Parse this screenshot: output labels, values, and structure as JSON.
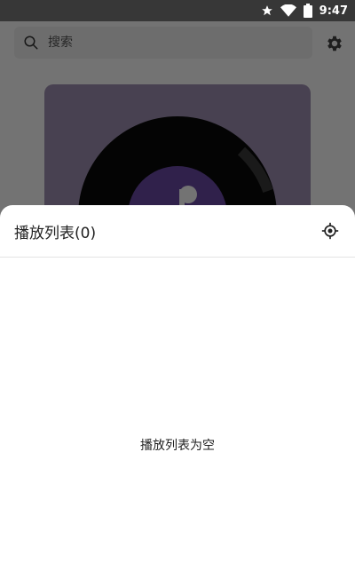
{
  "status_bar": {
    "time": "9:47",
    "icons": [
      "star-icon",
      "wifi-icon",
      "battery-icon"
    ]
  },
  "search": {
    "placeholder": "搜索"
  },
  "header_icons": {
    "settings": "gear-icon"
  },
  "playlist": {
    "title": "播放列表(0)",
    "empty_text": "播放列表为空",
    "locate_icon": "locate-icon"
  },
  "colors": {
    "album_bg": "#a191b3",
    "label_purple": "#6a4aa6"
  }
}
